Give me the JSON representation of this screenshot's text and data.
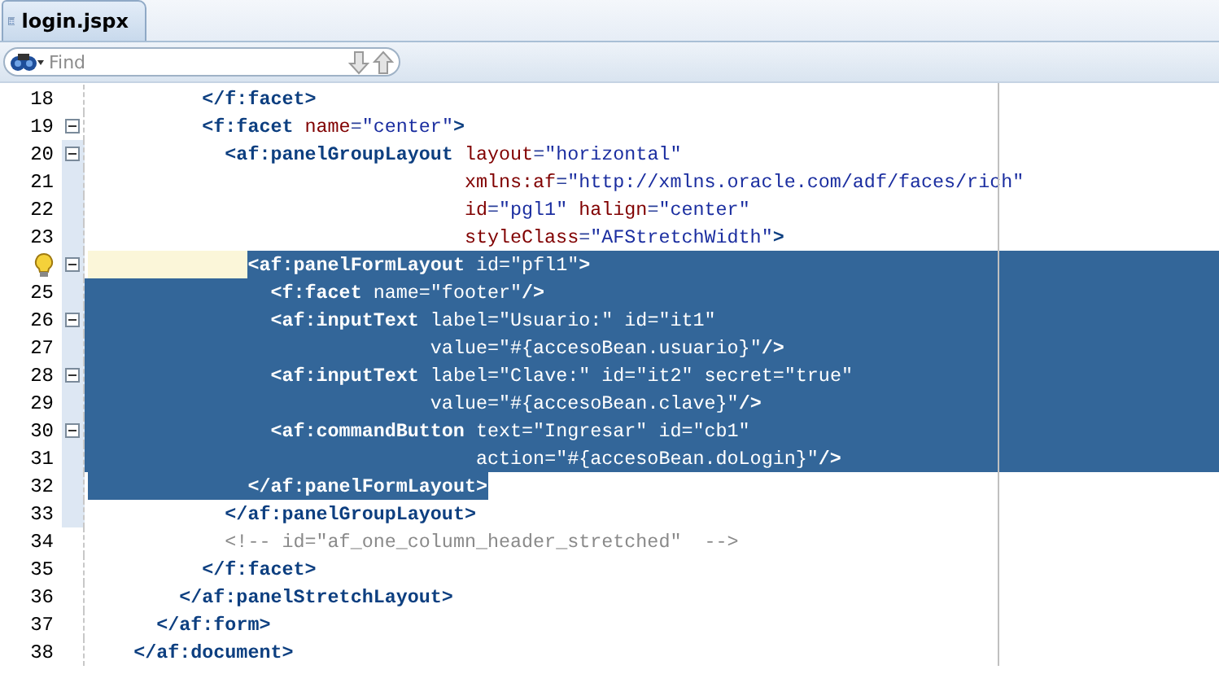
{
  "tab": {
    "title": "login.jspx",
    "selected": true
  },
  "find": {
    "placeholder": "Find"
  },
  "lines": [
    {
      "number": "18",
      "hint": false,
      "fold": false,
      "in_fold_range": false,
      "current": false,
      "selected": false,
      "tokens": [
        {
          "kind": "tag",
          "text": "          </f:facet>"
        }
      ]
    },
    {
      "number": "19",
      "hint": false,
      "fold": true,
      "in_fold_range": false,
      "current": false,
      "selected": false,
      "tokens": [
        {
          "kind": "tag",
          "text": "          <f:facet"
        },
        {
          "kind": "attr",
          "text": " name"
        },
        {
          "kind": "punct",
          "text": "="
        },
        {
          "kind": "str",
          "text": "\"center\""
        },
        {
          "kind": "tag",
          "text": ">"
        }
      ]
    },
    {
      "number": "20",
      "hint": false,
      "fold": true,
      "in_fold_range": true,
      "current": false,
      "selected": false,
      "tokens": [
        {
          "kind": "tag",
          "text": "            <af:panelGroupLayout"
        },
        {
          "kind": "attr",
          "text": " layout"
        },
        {
          "kind": "punct",
          "text": "="
        },
        {
          "kind": "str",
          "text": "\"horizontal\""
        }
      ]
    },
    {
      "number": "21",
      "hint": false,
      "fold": false,
      "in_fold_range": true,
      "current": false,
      "selected": false,
      "tokens": [
        {
          "kind": "attr",
          "text": "                                 xmlns:af"
        },
        {
          "kind": "punct",
          "text": "="
        },
        {
          "kind": "str",
          "text": "\"http://xmlns.oracle.com/adf/faces/rich\""
        }
      ]
    },
    {
      "number": "22",
      "hint": false,
      "fold": false,
      "in_fold_range": true,
      "current": false,
      "selected": false,
      "tokens": [
        {
          "kind": "attr",
          "text": "                                 id"
        },
        {
          "kind": "punct",
          "text": "="
        },
        {
          "kind": "str",
          "text": "\"pgl1\""
        },
        {
          "kind": "attr",
          "text": " halign"
        },
        {
          "kind": "punct",
          "text": "="
        },
        {
          "kind": "str",
          "text": "\"center\""
        }
      ]
    },
    {
      "number": "23",
      "hint": false,
      "fold": false,
      "in_fold_range": true,
      "current": false,
      "selected": false,
      "tokens": [
        {
          "kind": "attr",
          "text": "                                 styleClass"
        },
        {
          "kind": "punct",
          "text": "="
        },
        {
          "kind": "str",
          "text": "\"AFStretchWidth\""
        },
        {
          "kind": "tag",
          "text": ">"
        }
      ]
    },
    {
      "hint": true,
      "fold": true,
      "in_fold_range": true,
      "current": true,
      "selected": true,
      "tokens": [
        {
          "kind": "tag",
          "text": "              <af:panelFormLayout"
        },
        {
          "kind": "attr",
          "text": " id"
        },
        {
          "kind": "punct",
          "text": "="
        },
        {
          "kind": "str",
          "text": "\"pfl1\""
        },
        {
          "kind": "tag",
          "text": ">"
        }
      ]
    },
    {
      "number": "25",
      "hint": false,
      "fold": false,
      "in_fold_range": true,
      "current": false,
      "selected": true,
      "tokens": [
        {
          "kind": "tag",
          "text": "                <f:facet"
        },
        {
          "kind": "attr",
          "text": " name"
        },
        {
          "kind": "punct",
          "text": "="
        },
        {
          "kind": "str",
          "text": "\"footer\""
        },
        {
          "kind": "tag",
          "text": "/>"
        }
      ]
    },
    {
      "number": "26",
      "hint": false,
      "fold": true,
      "in_fold_range": true,
      "current": false,
      "selected": true,
      "tokens": [
        {
          "kind": "tag",
          "text": "                <af:inputText"
        },
        {
          "kind": "attr",
          "text": " label"
        },
        {
          "kind": "punct",
          "text": "="
        },
        {
          "kind": "str",
          "text": "\"Usuario:\""
        },
        {
          "kind": "attr",
          "text": " id"
        },
        {
          "kind": "punct",
          "text": "="
        },
        {
          "kind": "str",
          "text": "\"it1\""
        }
      ]
    },
    {
      "number": "27",
      "hint": false,
      "fold": false,
      "in_fold_range": true,
      "current": false,
      "selected": true,
      "tokens": [
        {
          "kind": "attr",
          "text": "                              value"
        },
        {
          "kind": "punct",
          "text": "="
        },
        {
          "kind": "str",
          "text": "\"#{accesoBean.usuario}\""
        },
        {
          "kind": "tag",
          "text": "/>"
        }
      ]
    },
    {
      "number": "28",
      "hint": false,
      "fold": true,
      "in_fold_range": true,
      "current": false,
      "selected": true,
      "tokens": [
        {
          "kind": "tag",
          "text": "                <af:inputText"
        },
        {
          "kind": "attr",
          "text": " label"
        },
        {
          "kind": "punct",
          "text": "="
        },
        {
          "kind": "str",
          "text": "\"Clave:\""
        },
        {
          "kind": "attr",
          "text": " id"
        },
        {
          "kind": "punct",
          "text": "="
        },
        {
          "kind": "str",
          "text": "\"it2\""
        },
        {
          "kind": "attr",
          "text": " secret"
        },
        {
          "kind": "punct",
          "text": "="
        },
        {
          "kind": "str",
          "text": "\"true\""
        }
      ]
    },
    {
      "number": "29",
      "hint": false,
      "fold": false,
      "in_fold_range": true,
      "current": false,
      "selected": true,
      "tokens": [
        {
          "kind": "attr",
          "text": "                              value"
        },
        {
          "kind": "punct",
          "text": "="
        },
        {
          "kind": "str",
          "text": "\"#{accesoBean.clave}\""
        },
        {
          "kind": "tag",
          "text": "/>"
        }
      ]
    },
    {
      "number": "30",
      "hint": false,
      "fold": true,
      "in_fold_range": true,
      "current": false,
      "selected": true,
      "tokens": [
        {
          "kind": "tag",
          "text": "                <af:commandButton"
        },
        {
          "kind": "attr",
          "text": " text"
        },
        {
          "kind": "punct",
          "text": "="
        },
        {
          "kind": "str",
          "text": "\"Ingresar\""
        },
        {
          "kind": "attr",
          "text": " id"
        },
        {
          "kind": "punct",
          "text": "="
        },
        {
          "kind": "str",
          "text": "\"cb1\""
        }
      ]
    },
    {
      "number": "31",
      "hint": false,
      "fold": false,
      "in_fold_range": true,
      "current": false,
      "selected": true,
      "tokens": [
        {
          "kind": "attr",
          "text": "                                  action"
        },
        {
          "kind": "punct",
          "text": "="
        },
        {
          "kind": "str",
          "text": "\"#{accesoBean.doLogin}\""
        },
        {
          "kind": "tag",
          "text": "/>"
        }
      ]
    },
    {
      "number": "32",
      "hint": false,
      "fold": false,
      "in_fold_range": true,
      "current": false,
      "selected": true,
      "tokens": [
        {
          "kind": "tag",
          "text": "              </af:panelFormLayout>"
        }
      ]
    },
    {
      "number": "33",
      "hint": false,
      "fold": false,
      "in_fold_range": true,
      "current": false,
      "selected": false,
      "tokens": [
        {
          "kind": "tag",
          "text": "            </af:panelGroupLayout>"
        }
      ]
    },
    {
      "number": "34",
      "hint": false,
      "fold": false,
      "in_fold_range": false,
      "current": false,
      "selected": false,
      "tokens": [
        {
          "kind": "comment",
          "text": "            <!-- id=\"af_one_column_header_stretched\"  -->"
        }
      ]
    },
    {
      "number": "35",
      "hint": false,
      "fold": false,
      "in_fold_range": false,
      "current": false,
      "selected": false,
      "tokens": [
        {
          "kind": "tag",
          "text": "          </f:facet>"
        }
      ]
    },
    {
      "number": "36",
      "hint": false,
      "fold": false,
      "in_fold_range": false,
      "current": false,
      "selected": false,
      "tokens": [
        {
          "kind": "tag",
          "text": "        </af:panelStretchLayout>"
        }
      ]
    },
    {
      "number": "37",
      "hint": false,
      "fold": false,
      "in_fold_range": false,
      "current": false,
      "selected": false,
      "tokens": [
        {
          "kind": "tag",
          "text": "      </af:form>"
        }
      ]
    },
    {
      "number": "38",
      "hint": false,
      "fold": false,
      "in_fold_range": false,
      "current": false,
      "selected": false,
      "tokens": [
        {
          "kind": "tag",
          "text": "    </af:document>"
        }
      ]
    }
  ]
}
